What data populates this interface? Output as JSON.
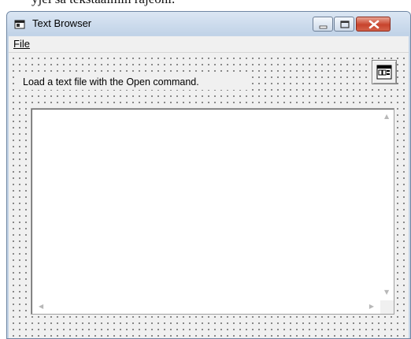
{
  "background_text": "yjeı̈ sa tekstaaimin rajeoni.",
  "window": {
    "title": "Text Browser",
    "icon": "app-window-icon",
    "buttons": {
      "minimize": "minimize-icon",
      "maximize": "maximize-icon",
      "close": "close-icon"
    }
  },
  "menu": {
    "items": [
      {
        "label": "File"
      }
    ]
  },
  "form": {
    "label": "Load a text file with the Open command.",
    "control_icon": "common-dialog-icon",
    "textbox_value": ""
  },
  "colors": {
    "titlebar": "#c8d8eb",
    "close_button": "#c8442d",
    "form_background": "#f0f0f0",
    "textbox_background": "#ffffff"
  }
}
